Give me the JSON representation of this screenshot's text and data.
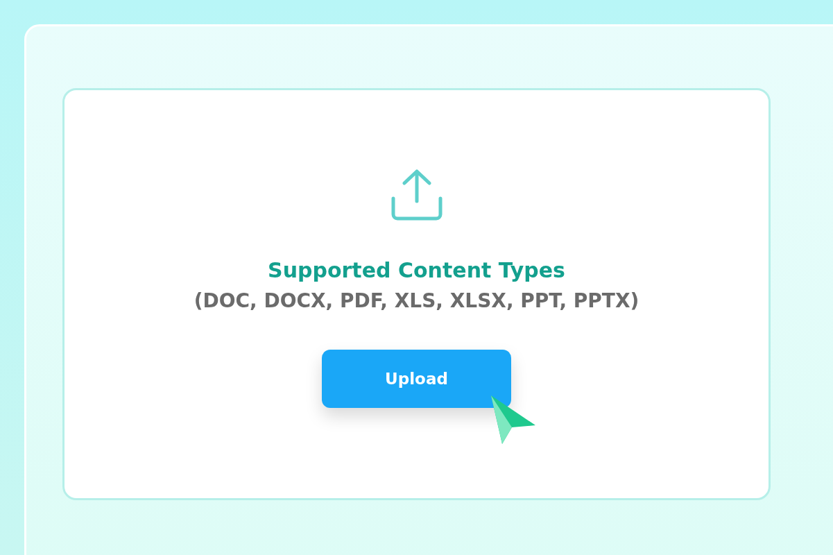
{
  "card": {
    "title": "Supported Content Types",
    "subtitle": "(DOC, DOCX, PDF, XLS, XLSX, PPT, PPTX)",
    "button": {
      "label": "Upload"
    }
  }
}
